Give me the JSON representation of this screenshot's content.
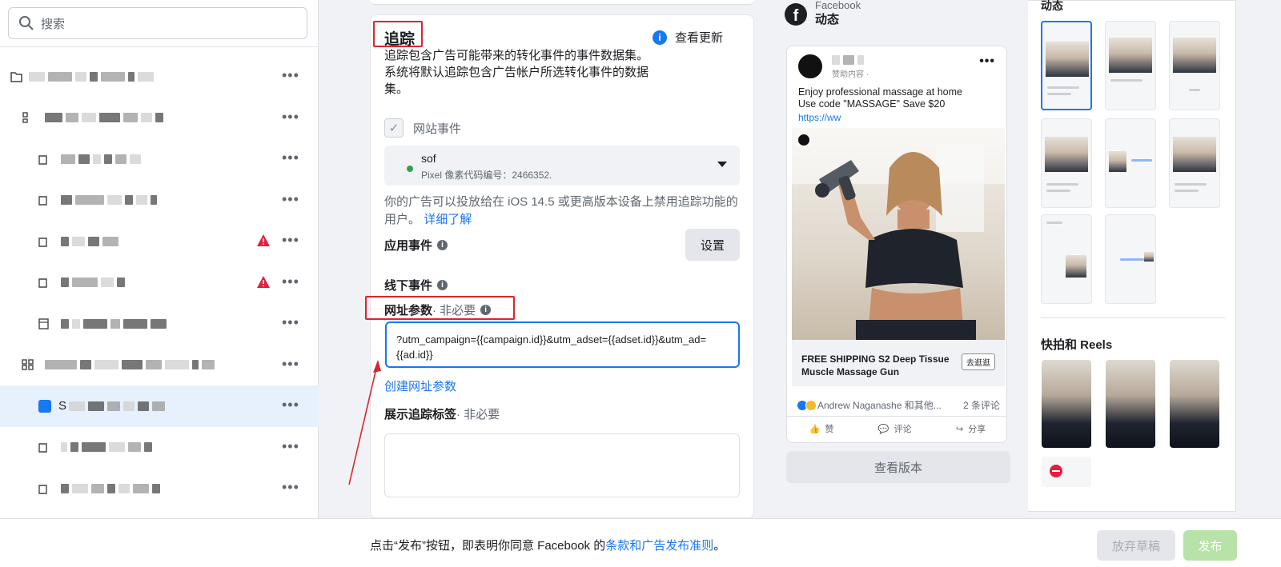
{
  "search": {
    "placeholder": "搜索"
  },
  "tracking": {
    "title": "追踪",
    "check_updates": "查看更新",
    "description": "追踪包含广告可能带来的转化事件的事件数据集。系统将默认追踪包含广告帐户所选转化事件的数据集。",
    "website_events_label": "网站事件",
    "pixel_name": "sof",
    "pixel_id_label": "Pixel 像素代码编号：2466352.",
    "ios_text": "你的广告可以投放给在 iOS 14.5 或更高版本设备上禁用追踪功能的用户。",
    "learn_more": "详细了解",
    "app_events_label": "应用事件",
    "app_events_button": "设置",
    "offline_events_label": "线下事件",
    "url_params_label": "网址参数",
    "url_params_optional": " · 非必要",
    "url_params_value": "?utm_campaign={{campaign.id}}&utm_adset={{adset.id}}&utm_ad={{ad.id}}",
    "create_url_params": "创建网址参数",
    "pixel_tag_label": "展示追踪标签",
    "pixel_tag_optional": " · 非必要"
  },
  "sidebar": {
    "selected_item_label": "S",
    "warning_color": "#e41e3f"
  },
  "preview": {
    "platform": "Facebook",
    "placement": "动态",
    "sponsored": "赞助内容 ·",
    "ad_text_line1": "Enjoy professional massage at home",
    "ad_text_line2": "Use code \"MASSAGE\" Save $20",
    "ad_link": "https://ww",
    "cta_title": "FREE SHIPPING S2 Deep Tissue Muscle Massage Gun",
    "cta_button": "去逛逛",
    "reaction_names": "Andrew Naganashe 和其他...",
    "comment_count": "2 条评论",
    "action_like": "赞",
    "action_comment": "评论",
    "action_share": "分享",
    "view_version": "查看版本",
    "feeds_title": "动态",
    "reels_title": "快拍和 Reels"
  },
  "footer": {
    "terms_prefix": "点击“发布”按钮，即表明你同意 Facebook 的",
    "terms_link": "条款和广告发布准则",
    "terms_suffix": "。",
    "discard": "放弃草稿",
    "publish": "发布"
  },
  "colors": {
    "accent": "#1877f2",
    "highlight": "#d9262e",
    "publish_disabled": "#b7e2a8"
  }
}
